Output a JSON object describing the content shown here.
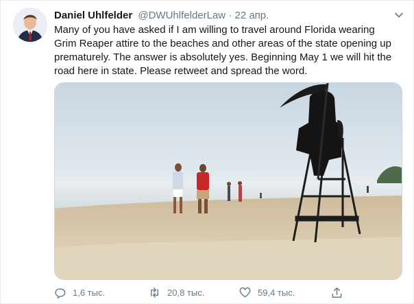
{
  "author": {
    "name": "Daniel Uhlfelder",
    "handle": "@DWUhlfelderLaw",
    "separator": "·",
    "date": "22 апр."
  },
  "tweet": {
    "text": "Many of you have asked if I am willing to travel around Florida wearing\nGrim Reaper attire to the beaches and other areas of the state opening up\nprematurely. The answer is absolutely yes. Beginning May 1 we will hit the\nroad here in state. Please retweet and spread the word."
  },
  "icons": {
    "chevron": "chevron-down-icon",
    "reply": "reply-icon",
    "retweet": "retweet-icon",
    "like": "heart-icon",
    "share": "share-icon"
  },
  "actions": {
    "reply_count": "1,6 тыс.",
    "retweet_count": "20,8 тыс.",
    "like_count": "59,4 тыс."
  },
  "colors": {
    "text": "#14171a",
    "muted": "#657786",
    "border": "#e6ecf0"
  }
}
